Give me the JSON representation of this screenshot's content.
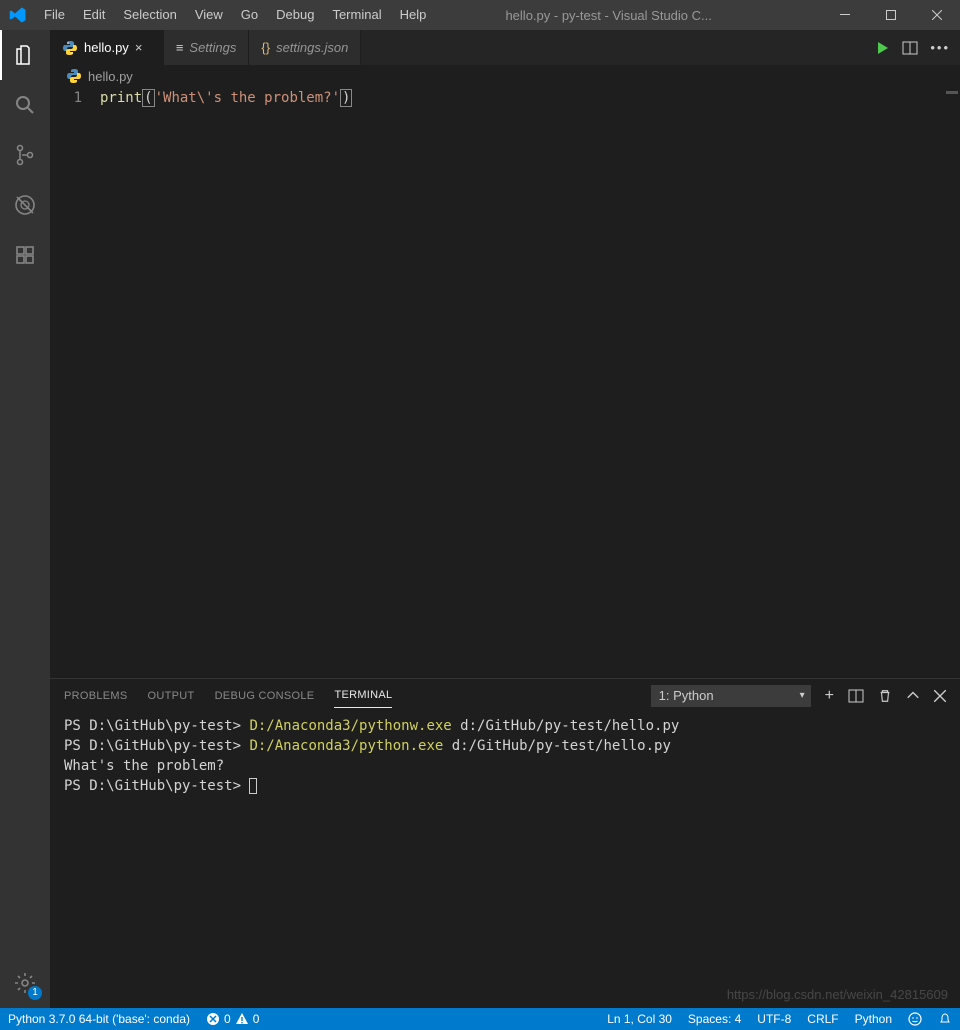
{
  "titlebar": {
    "title": "hello.py - py-test - Visual Studio C...",
    "menu": [
      "File",
      "Edit",
      "Selection",
      "View",
      "Go",
      "Debug",
      "Terminal",
      "Help"
    ]
  },
  "activitybar": {
    "badge": "1"
  },
  "tabs": [
    {
      "label": "hello.py",
      "active": true
    },
    {
      "label": "Settings",
      "active": false
    },
    {
      "label": "settings.json",
      "active": false
    }
  ],
  "breadcrumb": {
    "file": "hello.py"
  },
  "editor": {
    "lineno": "1",
    "fn": "print",
    "open": "(",
    "str": "'What\\'s the problem?'",
    "close": ")"
  },
  "panel": {
    "tabs": [
      "PROBLEMS",
      "OUTPUT",
      "DEBUG CONSOLE",
      "TERMINAL"
    ],
    "active": "TERMINAL",
    "select": "1: Python"
  },
  "terminal": {
    "l1_ps": "PS D:\\GitHub\\py-test> ",
    "l1_exe": "D:/Anaconda3/pythonw.exe",
    "l1_arg": " d:/GitHub/py-test/hello.py",
    "l2_ps": "PS D:\\GitHub\\py-test> ",
    "l2_exe": "D:/Anaconda3/python.exe",
    "l2_arg": " d:/GitHub/py-test/hello.py",
    "l3": "What's the problem?",
    "l4_ps": "PS D:\\GitHub\\py-test> "
  },
  "status": {
    "interpreter": "Python 3.7.0 64-bit ('base': conda)",
    "errors": "0",
    "warnings": "0",
    "ln": "Ln 1, Col 30",
    "spaces": "Spaces: 4",
    "encoding": "UTF-8",
    "eol": "CRLF",
    "lang": "Python"
  },
  "watermark": "https://blog.csdn.net/weixin_42815609"
}
